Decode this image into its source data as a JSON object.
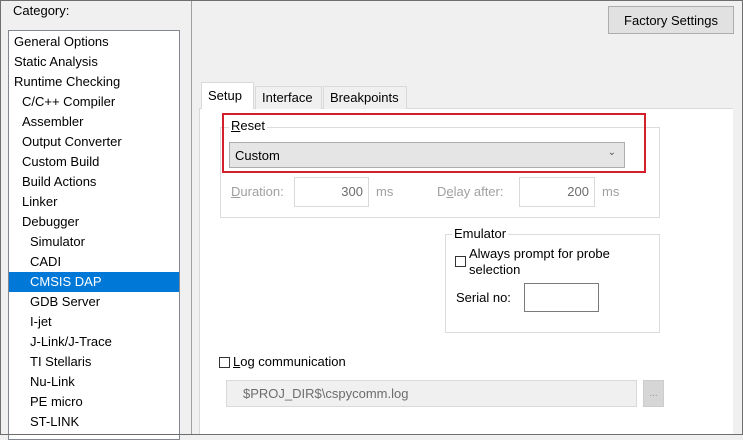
{
  "category": {
    "label": "Category:",
    "items": [
      {
        "label": "General Options",
        "indent": 0
      },
      {
        "label": "Static Analysis",
        "indent": 0
      },
      {
        "label": "Runtime Checking",
        "indent": 0
      },
      {
        "label": "C/C++ Compiler",
        "indent": 1
      },
      {
        "label": "Assembler",
        "indent": 1
      },
      {
        "label": "Output Converter",
        "indent": 1
      },
      {
        "label": "Custom Build",
        "indent": 1
      },
      {
        "label": "Build Actions",
        "indent": 1
      },
      {
        "label": "Linker",
        "indent": 1
      },
      {
        "label": "Debugger",
        "indent": 1
      },
      {
        "label": "Simulator",
        "indent": 2
      },
      {
        "label": "CADI",
        "indent": 2
      },
      {
        "label": "CMSIS DAP",
        "indent": 2,
        "selected": true
      },
      {
        "label": "GDB Server",
        "indent": 2
      },
      {
        "label": "I-jet",
        "indent": 2
      },
      {
        "label": "J-Link/J-Trace",
        "indent": 2
      },
      {
        "label": "TI Stellaris",
        "indent": 2
      },
      {
        "label": "Nu-Link",
        "indent": 2
      },
      {
        "label": "PE micro",
        "indent": 2
      },
      {
        "label": "ST-LINK",
        "indent": 2
      }
    ]
  },
  "toolbar": {
    "factory_settings_label": "Factory Settings"
  },
  "tabs": [
    {
      "label": "Setup",
      "active": true
    },
    {
      "label": "Interface",
      "active": false
    },
    {
      "label": "Breakpoints",
      "active": false
    }
  ],
  "reset": {
    "label_accel": "R",
    "label_rest": "eset",
    "selected_value": "Custom",
    "highlight_color": "#d3202a"
  },
  "duration": {
    "label_accel": "D",
    "label_rest": "uration:",
    "value": "300",
    "unit": "ms"
  },
  "delay": {
    "label_pre": "D",
    "label_accel": "e",
    "label_rest": "lay after:",
    "value": "200",
    "unit": "ms"
  },
  "emulator": {
    "title": "Emulator",
    "always_prompt_label_line1": "Always prompt for probe",
    "always_prompt_label_line2": "selection",
    "always_prompt_checked": false,
    "serial_label": "Serial no:",
    "serial_value": ""
  },
  "log": {
    "label_accel": "L",
    "label_rest": "og communication",
    "checked": false,
    "path": "$PROJ_DIR$\\cspycomm.log",
    "browse_label": "..."
  },
  "colors": {
    "selection": "#0078d7",
    "window_bg": "#f0f0f0"
  }
}
